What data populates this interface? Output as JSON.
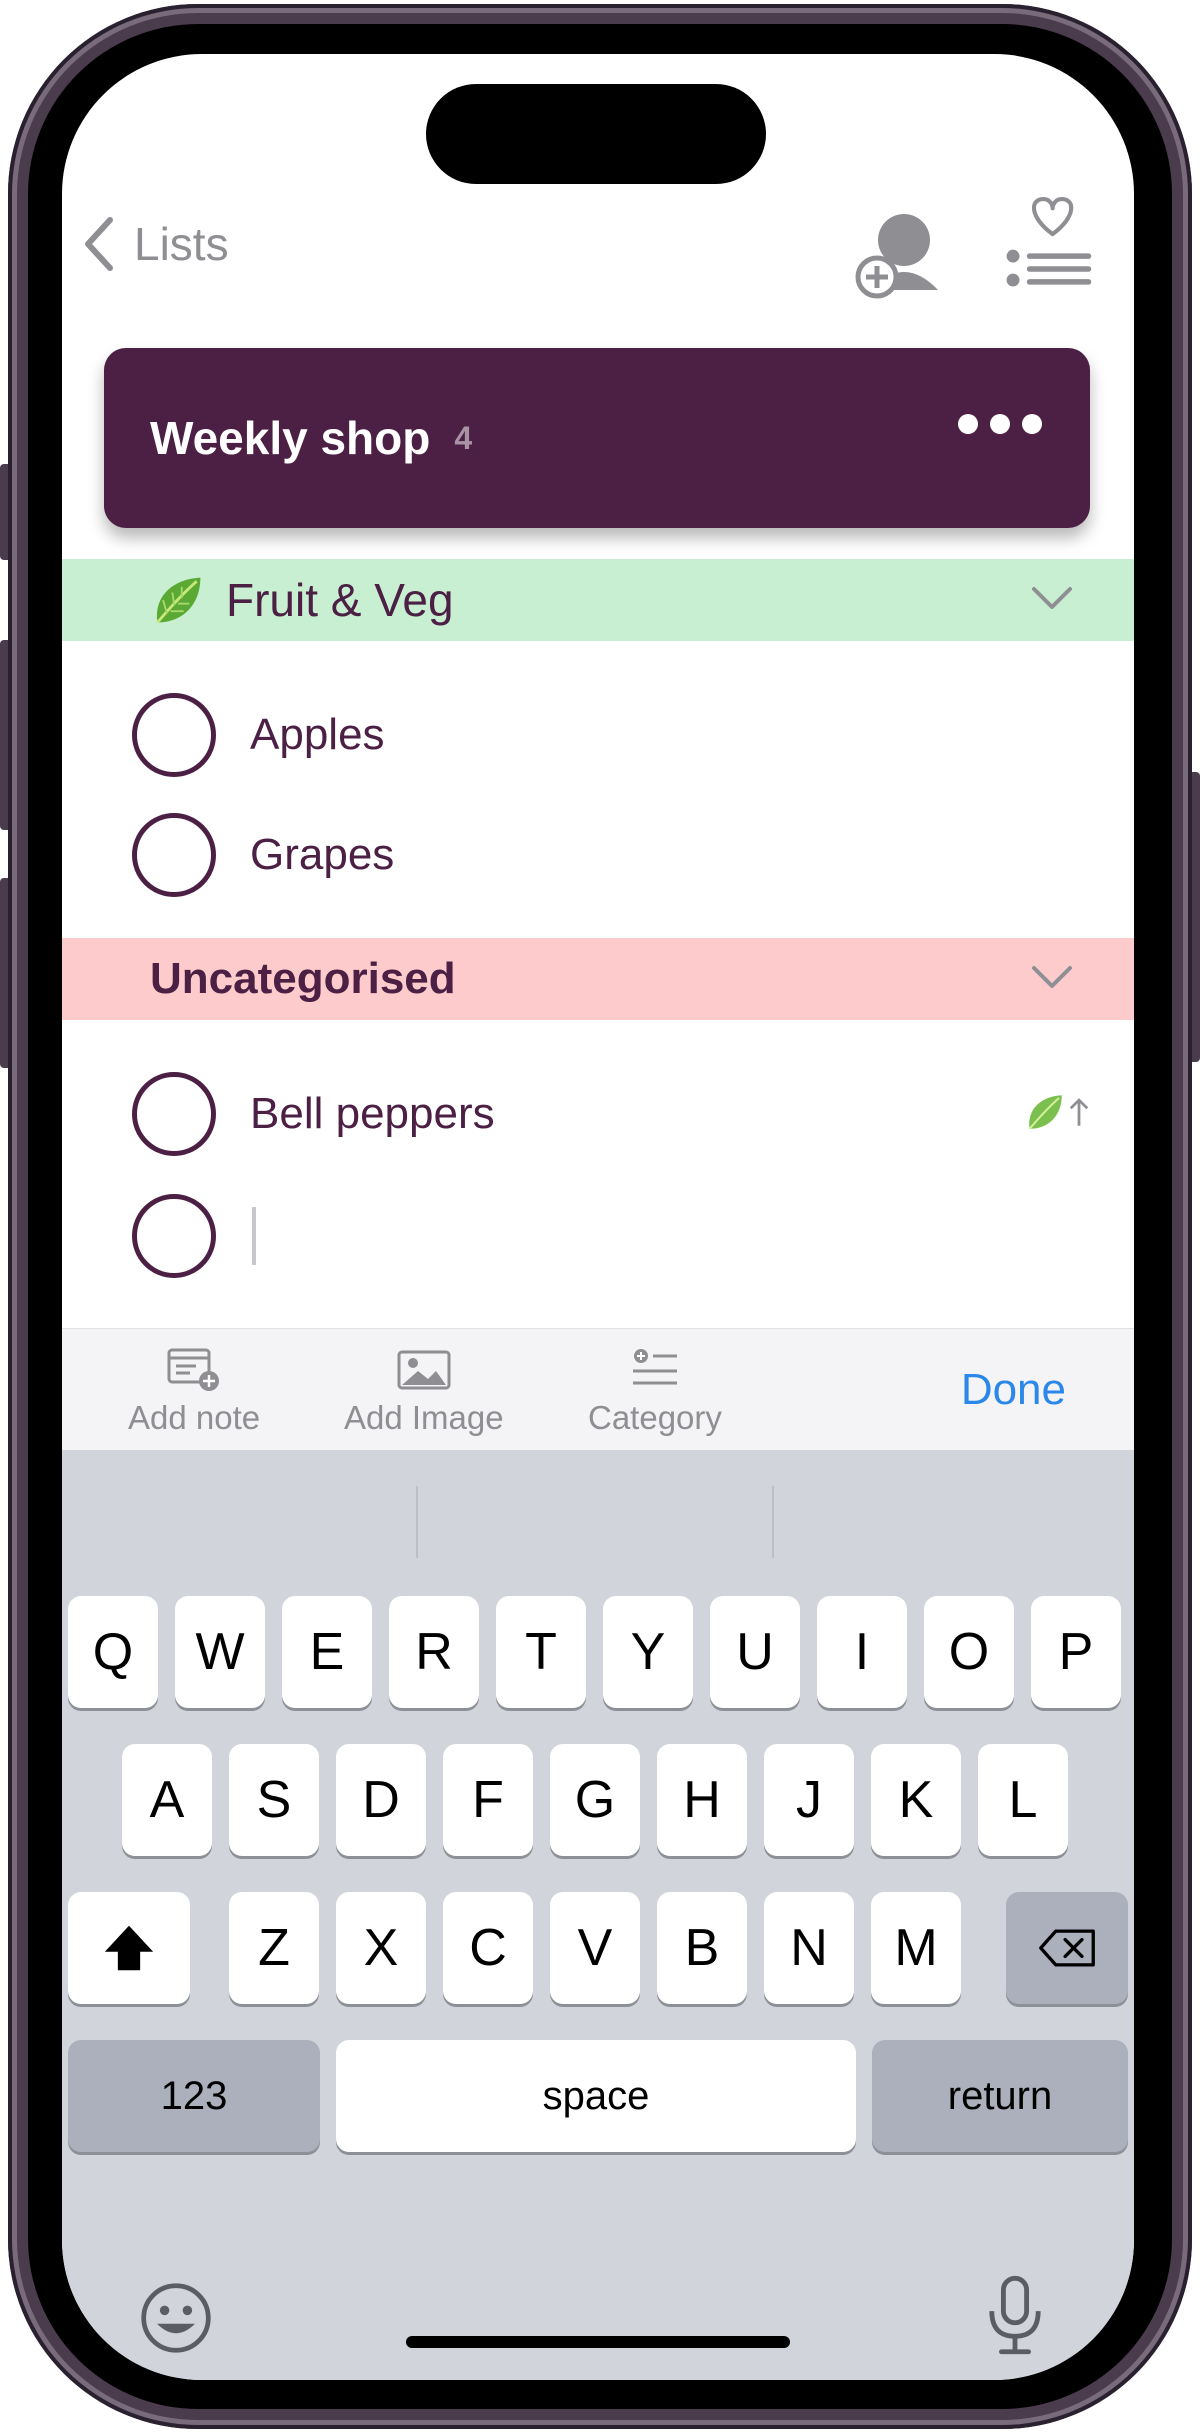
{
  "nav": {
    "back_label": "Lists"
  },
  "list": {
    "title": "Weekly shop",
    "count": "4"
  },
  "categories": [
    {
      "label": "Fruit & Veg",
      "color": "#c9efd2",
      "items": [
        {
          "label": "Apples"
        },
        {
          "label": "Grapes"
        }
      ]
    },
    {
      "label": "Uncategorised",
      "color": "#fdcbcb",
      "items": [
        {
          "label": "Bell peppers"
        },
        {
          "label": ""
        }
      ]
    }
  ],
  "toolbar": {
    "add_note": "Add note",
    "add_image": "Add Image",
    "category": "Category",
    "done": "Done"
  },
  "keyboard": {
    "row1": [
      "Q",
      "W",
      "E",
      "R",
      "T",
      "Y",
      "U",
      "I",
      "O",
      "P"
    ],
    "row2": [
      "A",
      "S",
      "D",
      "F",
      "G",
      "H",
      "J",
      "K",
      "L"
    ],
    "row3": [
      "Z",
      "X",
      "C",
      "V",
      "B",
      "N",
      "M"
    ],
    "numbers_label": "123",
    "space_label": "space",
    "return_label": "return"
  },
  "colors": {
    "accent": "#4b2044",
    "done_blue": "#2b87e8",
    "fruit_bg": "#c9efd2",
    "uncat_bg": "#fdcbcb"
  }
}
